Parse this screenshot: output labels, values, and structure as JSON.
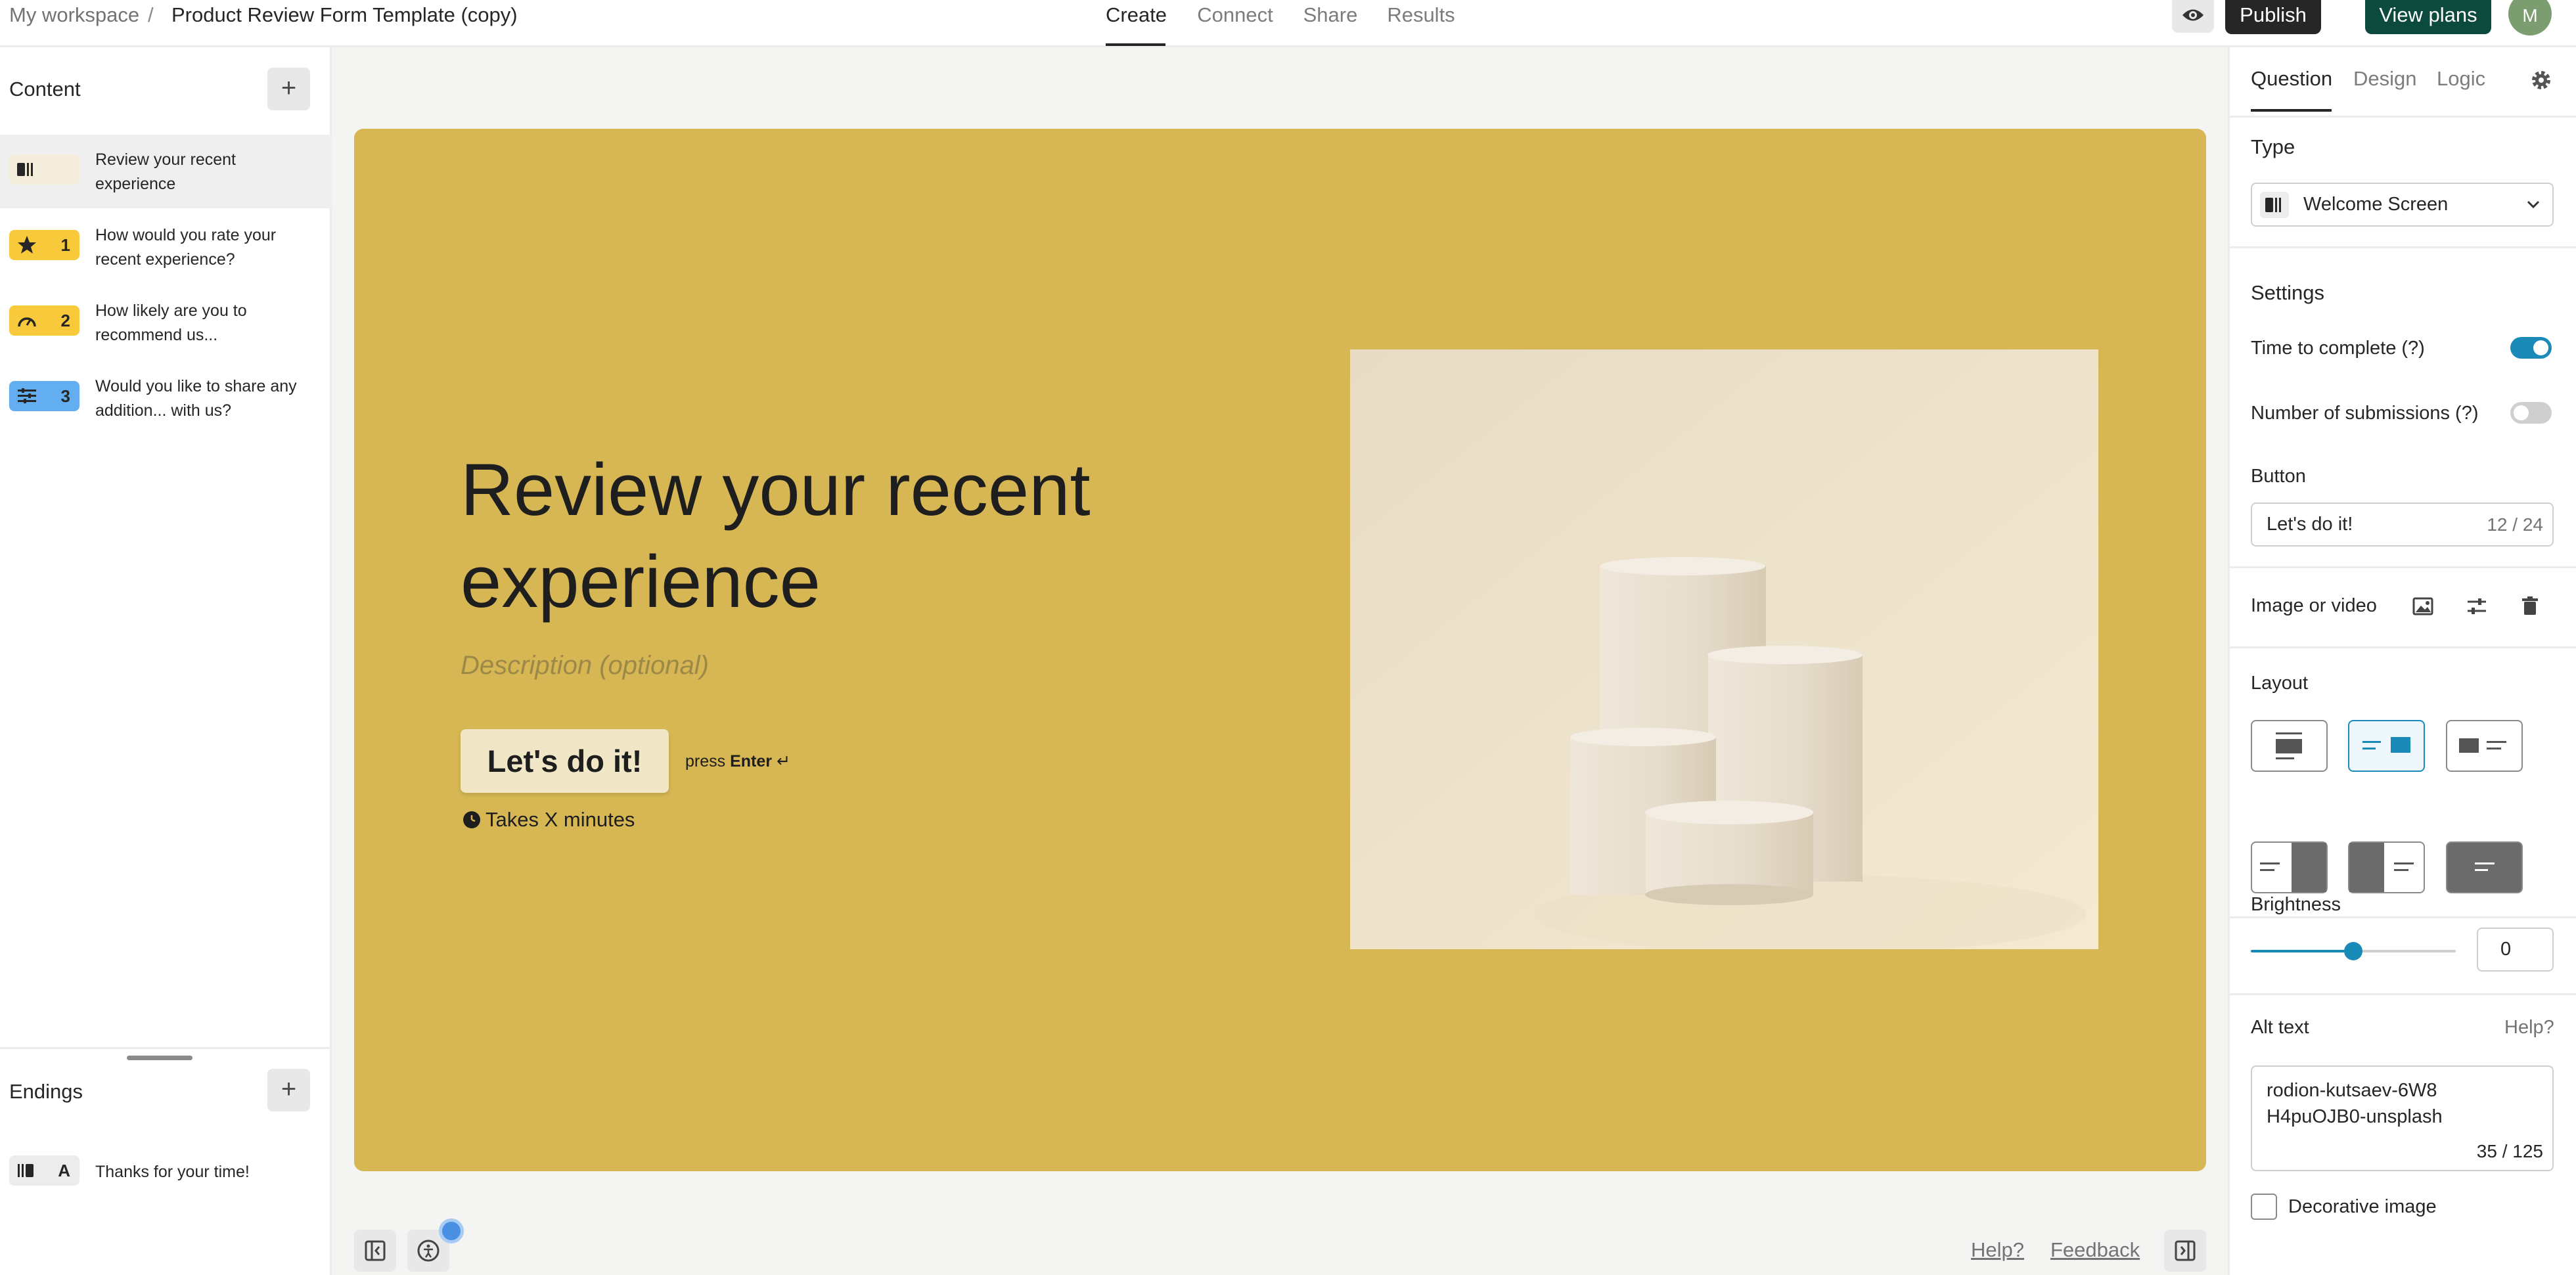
{
  "breadcrumb": {
    "workspace": "My workspace",
    "separator": "/",
    "form_name": "Product Review Form Template (copy)"
  },
  "nav_tabs": [
    {
      "label": "Create",
      "active": true
    },
    {
      "label": "Connect",
      "active": false
    },
    {
      "label": "Share",
      "active": false
    },
    {
      "label": "Results",
      "active": false
    }
  ],
  "top_actions": {
    "preview_icon": "eye-icon",
    "publish_label": "Publish",
    "view_plans_label": "View plans",
    "avatar_initial": "M"
  },
  "colors": {
    "canvas_bg": "#d6b753",
    "publish_bg": "#262626",
    "plans_bg": "#0d4a3e",
    "toggle_on": "#1a8ab8",
    "toggle_off": "#cfcfcf",
    "rating_badge": "#f8c93a",
    "multi_badge": "#62aef0"
  },
  "content_panel": {
    "title": "Content",
    "add_icon": "+",
    "items": [
      {
        "icon": "welcome-screen-icon",
        "number": "",
        "text": "Review your recent experience",
        "selected": true
      },
      {
        "icon": "star-icon",
        "number": "1",
        "text": "How would you rate your recent experience?",
        "selected": false
      },
      {
        "icon": "gauge-icon",
        "number": "2",
        "text": "How likely are you to recommend us...",
        "selected": false
      },
      {
        "icon": "multi-question-icon",
        "number": "3",
        "text": "Would you like to share any addition... with us?",
        "selected": false
      }
    ]
  },
  "endings_panel": {
    "title": "Endings",
    "add_icon": "+",
    "items": [
      {
        "icon": "ending-screen-icon",
        "letter": "A",
        "text": "Thanks for your time!"
      }
    ]
  },
  "welcome_screen": {
    "title": "Review your recent experience",
    "description_placeholder": "Description (optional)",
    "button_label": "Let's do it!",
    "press_prefix": "press",
    "press_key": "Enter",
    "press_glyph": "↵",
    "time_text": "Takes X minutes",
    "image_alt": "rodion-kutsaev-6W8H4puOJB0-unsplash"
  },
  "bottom_bar": {
    "help_label": "Help?",
    "feedback_label": "Feedback"
  },
  "right_panel": {
    "tabs": [
      {
        "label": "Question",
        "active": true
      },
      {
        "label": "Design",
        "active": false
      },
      {
        "label": "Logic",
        "active": false
      }
    ],
    "type_label": "Type",
    "type_value": "Welcome Screen",
    "settings_label": "Settings",
    "time_to_complete_label": "Time to complete (?)",
    "time_to_complete_on": true,
    "submissions_label": "Number of submissions (?)",
    "submissions_on": false,
    "button_label": "Button",
    "button_value": "Let's do it!",
    "button_counter": "12 / 24",
    "image_label": "Image or video",
    "layout_label": "Layout",
    "layout_selected_index": 1,
    "brightness_label": "Brightness",
    "brightness_value": "0",
    "brightness_level": 0.5,
    "alt_text_label": "Alt text",
    "alt_help_label": "Help?",
    "alt_value": "rodion-kutsaev-6W8H4puOJB0-unsplash",
    "alt_counter": "35 / 125",
    "decorative_label": "Decorative image",
    "decorative_checked": false
  }
}
